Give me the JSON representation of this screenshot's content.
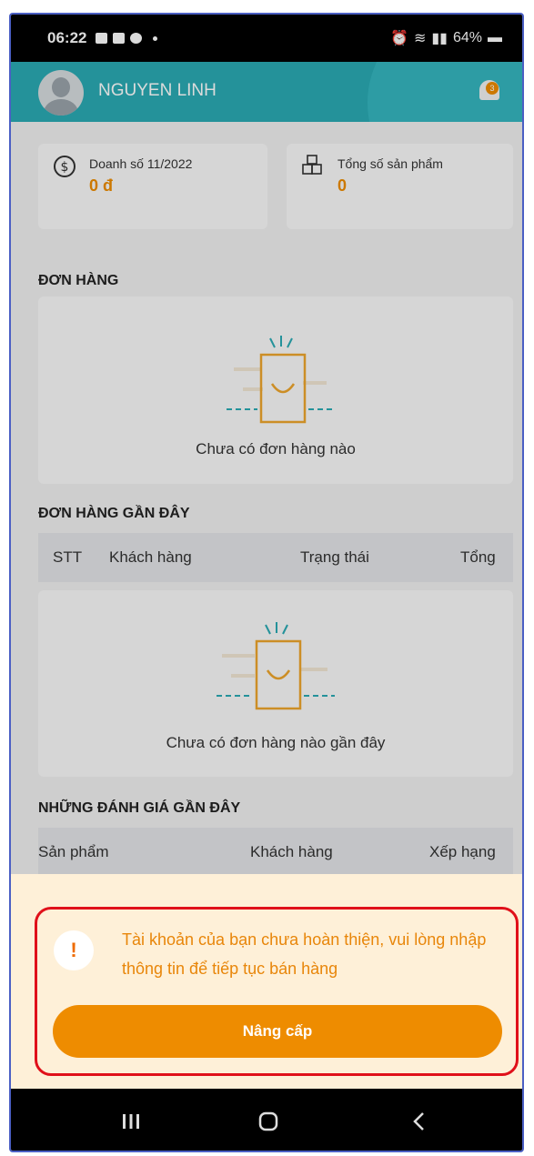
{
  "status_bar": {
    "time": "06:22",
    "battery": "64%"
  },
  "header": {
    "user_name": "NGUYEN LINH",
    "notification_badge": "3"
  },
  "stats": [
    {
      "label": "Doanh số 11/2022",
      "value": "0 đ",
      "icon": "dollar-circle-icon"
    },
    {
      "label": "Tổng số sản phẩm",
      "value": "0",
      "icon": "products-grid-icon"
    }
  ],
  "orders": {
    "title": "ĐƠN HÀNG",
    "empty_message": "Chưa có đơn hàng nào"
  },
  "recent_orders": {
    "title": "ĐƠN HÀNG GẦN ĐÂY",
    "columns": [
      "STT",
      "Khách hàng",
      "Trạng thái",
      "Tổng"
    ],
    "empty_message": "Chưa có đơn hàng nào gần đây"
  },
  "recent_reviews": {
    "title": "NHỮNG ĐÁNH GIÁ GẦN ĐÂY",
    "columns": [
      "Sản phẩm",
      "Khách hàng",
      "Xếp hạng"
    ]
  },
  "alert": {
    "icon_text": "!",
    "message": "Tài khoản của bạn chưa hoàn thiện, vui lòng nhập thông tin để tiếp tục bán hàng",
    "button_label": "Nâng cấp"
  },
  "nav_bar": {
    "icons": [
      "recent-apps-icon",
      "home-icon",
      "back-icon"
    ]
  },
  "colors": {
    "header": "#2aabb4",
    "accent": "#ee8c00",
    "alert_border": "#e0101a",
    "alert_bg": "#fef0d8"
  }
}
